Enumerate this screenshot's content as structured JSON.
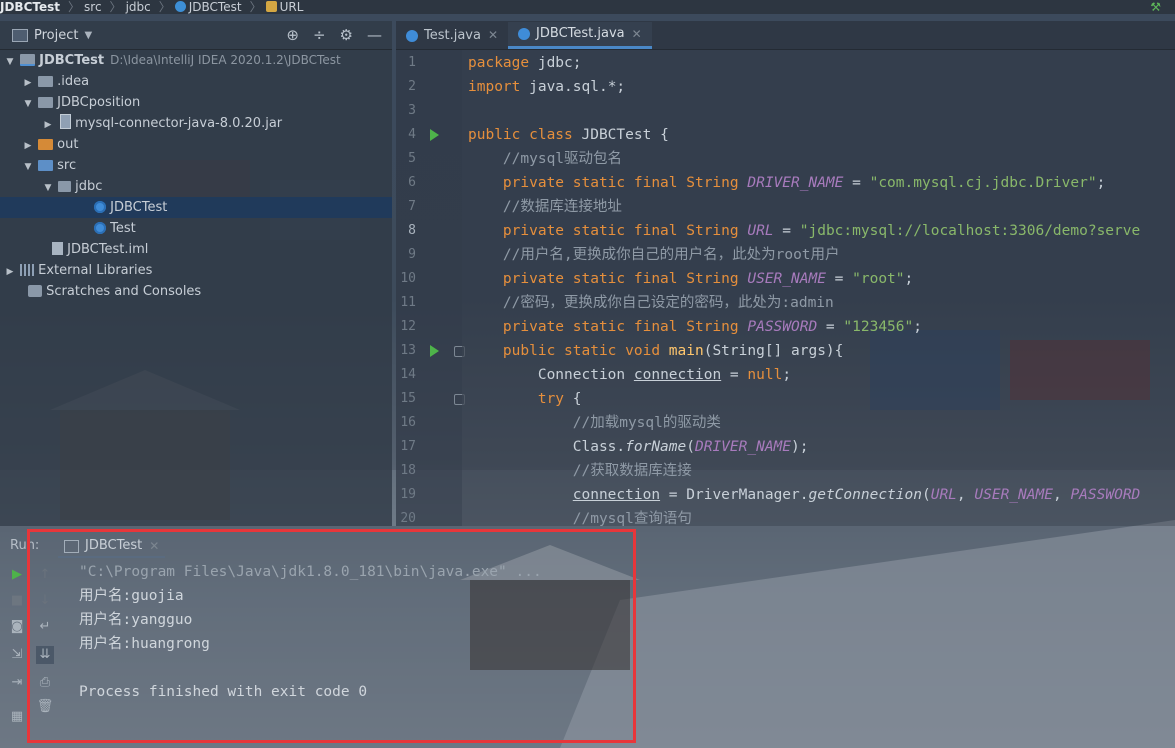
{
  "navbar": {
    "crumbs": [
      "JDBCTest",
      "src",
      "jdbc",
      "JDBCTest",
      "URL"
    ]
  },
  "project_panel": {
    "title": "Project",
    "tree": [
      {
        "label": "JDBCTest",
        "path": "D:\\Idea\\IntelliJ IDEA 2020.1.2\\JDBCTest",
        "icon": "folder-module-icon"
      },
      {
        "label": ".idea",
        "icon": "folder-icon"
      },
      {
        "label": "JDBCposition",
        "icon": "folder-icon"
      },
      {
        "label": "mysql-connector-java-8.0.20.jar",
        "icon": "jar-icon"
      },
      {
        "label": "out",
        "icon": "folder-orange-icon"
      },
      {
        "label": "src",
        "icon": "folder-blue-icon"
      },
      {
        "label": "jdbc",
        "icon": "package-icon"
      },
      {
        "label": "JDBCTest",
        "icon": "class-icon",
        "selected": true
      },
      {
        "label": "Test",
        "icon": "class-icon"
      },
      {
        "label": "JDBCTest.iml",
        "icon": "iml-file-icon"
      },
      {
        "label": "External Libraries",
        "icon": "libraries-icon"
      },
      {
        "label": "Scratches and Consoles",
        "icon": "scratches-icon"
      }
    ]
  },
  "editor": {
    "tabs": [
      {
        "label": "Test.java",
        "active": false
      },
      {
        "label": "JDBCTest.java",
        "active": true
      }
    ],
    "current_line": 8,
    "lines": [
      {
        "n": "1",
        "t": [
          "package jdbc;"
        ]
      },
      {
        "n": "2",
        "t": [
          "import java.sql.*;"
        ]
      },
      {
        "n": "3",
        "t": [
          ""
        ]
      },
      {
        "n": "4",
        "t": [
          "public class JDBCTest {"
        ]
      },
      {
        "n": "5",
        "t": [
          "    //mysql驱动包名"
        ]
      },
      {
        "n": "6",
        "t": [
          "    private static final String ",
          "DRIVER_NAME",
          " = ",
          "\"com.mysql.cj.jdbc.Driver\"",
          ";"
        ]
      },
      {
        "n": "7",
        "t": [
          "    //数据库连接地址"
        ]
      },
      {
        "n": "8",
        "t": [
          "    private static final String ",
          "URL",
          " = ",
          "\"jdbc:mysql://localhost:3306/demo?serve"
        ]
      },
      {
        "n": "9",
        "t": [
          "    //用户名,更换成你自己的用户名，此处为root用户"
        ]
      },
      {
        "n": "10",
        "t": [
          "    private static final String ",
          "USER_NAME",
          " = ",
          "\"root\"",
          ";"
        ]
      },
      {
        "n": "11",
        "t": [
          "    //密码，更换成你自己设定的密码，此处为:admin"
        ]
      },
      {
        "n": "12",
        "t": [
          "    private static final String ",
          "PASSWORD",
          " = ",
          "\"123456\"",
          ";"
        ]
      },
      {
        "n": "13",
        "t": [
          "    public static void ",
          "main",
          "(String[] args){"
        ]
      },
      {
        "n": "14",
        "t": [
          "        Connection ",
          "connection",
          " = ",
          "null",
          ";"
        ]
      },
      {
        "n": "15",
        "t": [
          "        try {"
        ]
      },
      {
        "n": "16",
        "t": [
          "            //加载mysql的驱动类"
        ]
      },
      {
        "n": "17",
        "t": [
          "            Class.",
          "forName",
          "(",
          "DRIVER_NAME",
          ");"
        ]
      },
      {
        "n": "18",
        "t": [
          "            //获取数据库连接"
        ]
      },
      {
        "n": "19",
        "t": [
          "            ",
          "connection",
          " = DriverManager.",
          "getConnection",
          "(",
          "URL",
          ", ",
          "USER_NAME",
          ", ",
          "PASSWORD"
        ]
      },
      {
        "n": "20",
        "t": [
          "            //mysql查询语句"
        ]
      }
    ]
  },
  "run_panel": {
    "label": "Run:",
    "tab": "JDBCTest",
    "console": [
      "\"C:\\Program Files\\Java\\jdk1.8.0_181\\bin\\java.exe\" ...",
      "用户名:guojia",
      "用户名:yangguo",
      "用户名:huangrong",
      "",
      "Process finished with exit code 0"
    ]
  },
  "colors": {
    "keyword": "#e68f3c",
    "string": "#89b86a",
    "constant": "#a87bbd",
    "comment": "#8f9aa6",
    "highlight_box": "#e8363a",
    "run_green": "#4eb34a"
  }
}
